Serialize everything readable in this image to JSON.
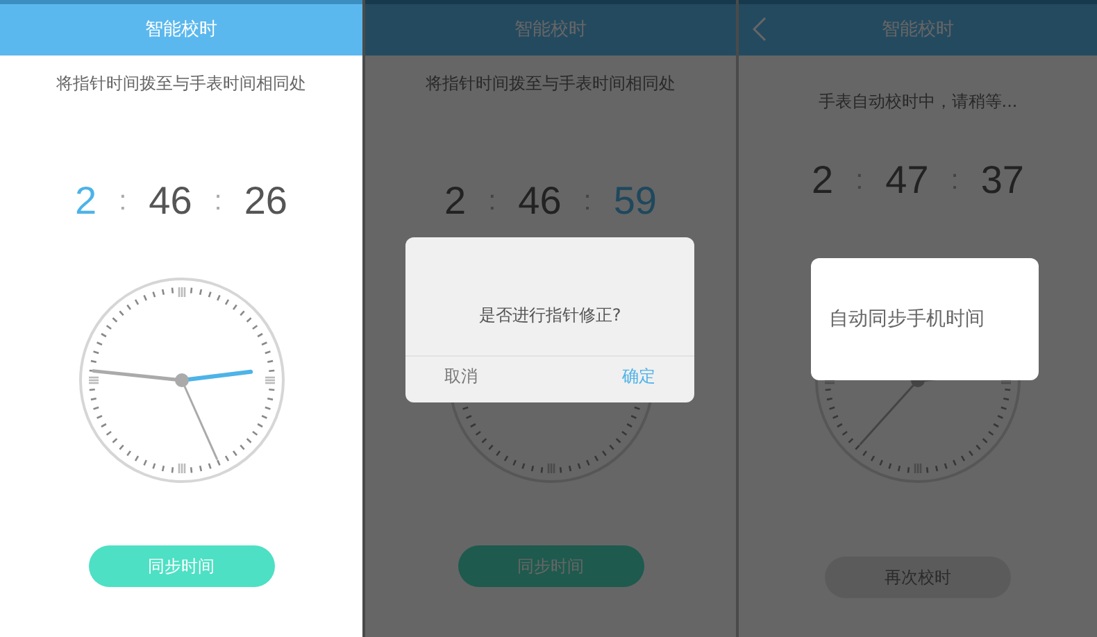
{
  "screens": [
    {
      "header": {
        "title": "智能校时",
        "back": false
      },
      "instruction": "将指针时间拨至与手表时间相同处",
      "time": [
        {
          "value": "2",
          "selected": true
        },
        {
          "value": "46",
          "selected": false
        },
        {
          "value": "26",
          "selected": false
        }
      ],
      "separators": [
        ":",
        ":"
      ],
      "button": {
        "label": "同步时间",
        "disabled": false
      },
      "dimmed": false
    },
    {
      "header": {
        "title": "智能校时",
        "back": false
      },
      "instruction": "将指针时间拨至与手表时间相同处",
      "time": [
        {
          "value": "2",
          "selected": false
        },
        {
          "value": "46",
          "selected": false
        },
        {
          "value": "59",
          "selected": true
        }
      ],
      "separators": [
        ":",
        ":"
      ],
      "button": {
        "label": "同步时间",
        "disabled": false
      },
      "dimmed": true,
      "dialog": {
        "kind": "confirm",
        "message": "是否进行指针修正?",
        "buttons": [
          {
            "label": "取消",
            "kind": "cancel"
          },
          {
            "label": "确定",
            "kind": "confirm"
          }
        ]
      }
    },
    {
      "header": {
        "title": "智能校时",
        "back": true
      },
      "instruction": "手表自动校时中，请稍等...",
      "time": [
        {
          "value": "2",
          "selected": false
        },
        {
          "value": "47",
          "selected": false
        },
        {
          "value": "37",
          "selected": false
        }
      ],
      "separators": [
        ":",
        ":"
      ],
      "button": {
        "label": "再次校时",
        "disabled": true
      },
      "dimmed": true,
      "dialog": {
        "kind": "toast",
        "message": "自动同步手机时间"
      }
    }
  ]
}
